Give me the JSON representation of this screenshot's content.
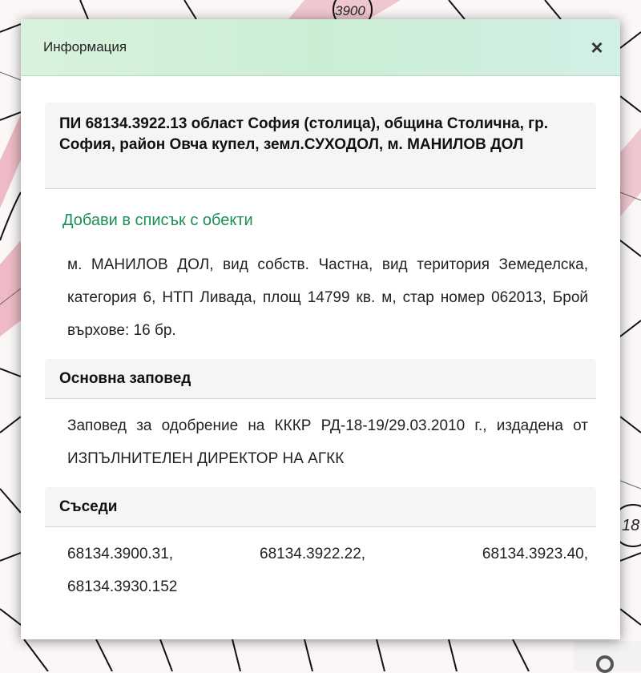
{
  "map": {
    "label_top": "3900",
    "label_right": "18"
  },
  "dialog": {
    "title": "Информация",
    "close_glyph": "×",
    "parcel_title": "ПИ 68134.3922.13 област София (столица), община Столична, гр. София, район Овча купел, земл.СУХОДОЛ, м. МАНИЛОВ ДОЛ",
    "add_link": "Добави в списък с обекти",
    "description": "м. МАНИЛОВ ДОЛ, вид собств. Частна, вид територия Земеделска, категория 6, НТП Ливада, площ 14799 кв. м, стар номер 062013, Брой върхове: 16 бр.",
    "order_section_title": "Основна заповед",
    "order_text": "Заповед за одобрение на КККР РД-18-19/29.03.2010 г., издадена от ИЗПЪЛНИТЕЛЕН ДИРЕКТОР НА АГКК",
    "neighbors_section_title": "Съседи",
    "neighbors": [
      "68134.3900.31,",
      "68134.3922.22,",
      "68134.3923.40,",
      "68134.3930.152"
    ]
  },
  "colors": {
    "header_bg": "#cbeed3",
    "link": "#1a8f56",
    "map_stripe": "#e8a6b4"
  },
  "icons": {
    "close": "close-icon",
    "locate": "map-locate-icon"
  }
}
